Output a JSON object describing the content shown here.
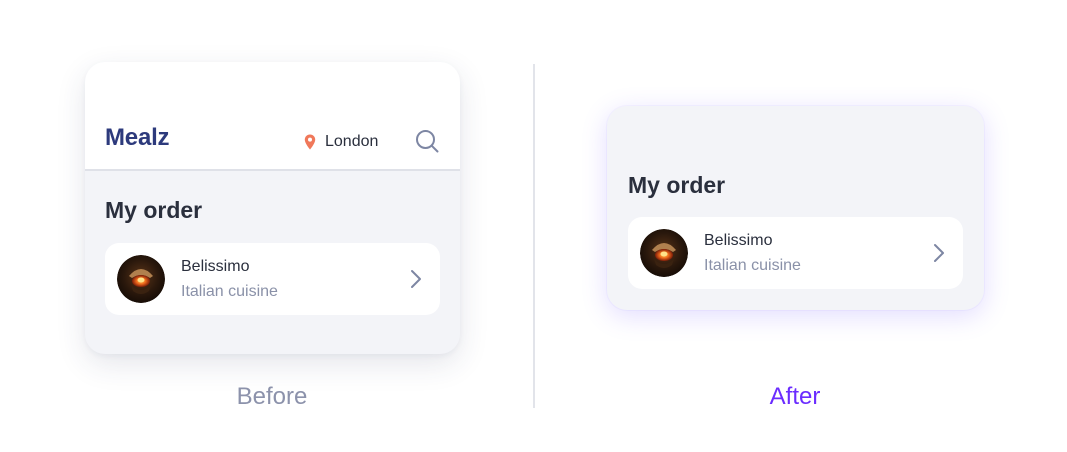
{
  "before": {
    "header": {
      "brand": "Mealz",
      "location": "London"
    },
    "section_title": "My order",
    "order_item": {
      "name": "Belissimo",
      "subtitle": "Italian cuisine"
    },
    "caption": "Before"
  },
  "after": {
    "section_title": "My order",
    "order_item": {
      "name": "Belissimo",
      "subtitle": "Italian cuisine"
    },
    "caption": "After"
  },
  "icons": {
    "location": "map-pin-icon",
    "search": "search-icon",
    "chevron": "chevron-right-icon"
  },
  "colors": {
    "brand": "#2d3a7c",
    "pin": "#f0785a",
    "accent": "#6b2cff",
    "muted_text": "#8a91a8",
    "card_background": "#f3f4f8"
  }
}
